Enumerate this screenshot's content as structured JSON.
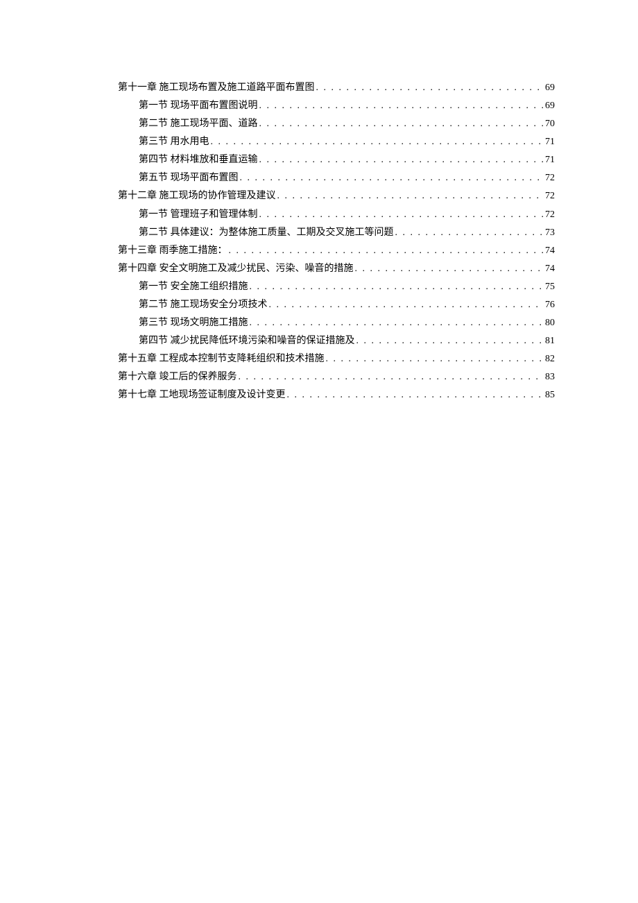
{
  "toc": [
    {
      "level": 0,
      "label": "第十一章 施工现场布置及施工道路平面布置图",
      "page": "69"
    },
    {
      "level": 1,
      "label": "第一节 现场平面布置图说明",
      "page": "69"
    },
    {
      "level": 1,
      "label": "第二节 施工现场平面、道路",
      "page": "70"
    },
    {
      "level": 1,
      "label": "第三节 用水用电",
      "page": "71"
    },
    {
      "level": 1,
      "label": "第四节 材料堆放和垂直运输",
      "page": "71"
    },
    {
      "level": 1,
      "label": "第五节 现场平面布置图",
      "page": "72"
    },
    {
      "level": 0,
      "label": "第十二章 施工现场的协作管理及建议",
      "page": "72"
    },
    {
      "level": 1,
      "label": "第一节 管理班子和管理体制",
      "page": "72"
    },
    {
      "level": 1,
      "label": "第二节 具体建议：为整体施工质量、工期及交叉施工等问题",
      "page": "73"
    },
    {
      "level": 0,
      "label": "第十三章 雨季施工措施：",
      "page": "74"
    },
    {
      "level": 0,
      "label": "第十四章 安全文明施工及减少扰民、污染、噪音的措施",
      "page": "74"
    },
    {
      "level": 1,
      "label": "第一节 安全施工组织措施",
      "page": "75"
    },
    {
      "level": 1,
      "label": "第二节 施工现场安全分项技术",
      "page": "76"
    },
    {
      "level": 1,
      "label": "第三节 现场文明施工措施",
      "page": "80"
    },
    {
      "level": 1,
      "label": "第四节 减少扰民降低环境污染和噪音的保证措施及",
      "page": "81"
    },
    {
      "level": 0,
      "label": "第十五章 工程成本控制节支降耗组织和技术措施",
      "page": "82"
    },
    {
      "level": 0,
      "label": "第十六章 竣工后的保养服务",
      "page": "83"
    },
    {
      "level": 0,
      "label": "第十七章 工地现场签证制度及设计变更",
      "page": "85"
    }
  ]
}
